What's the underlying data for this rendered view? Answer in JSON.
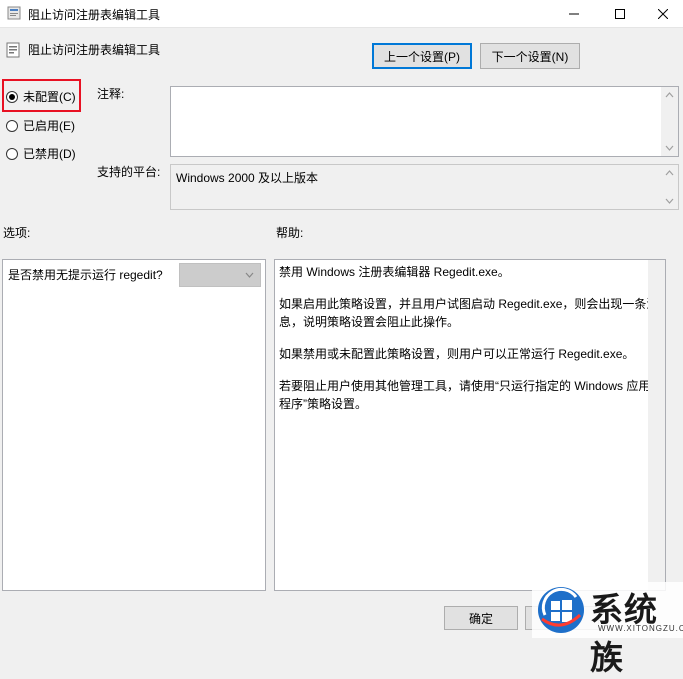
{
  "window": {
    "title": "阻止访问注册表编辑工具",
    "controls": {
      "minimize": "minimize-icon",
      "maximize": "maximize-icon",
      "close": "close-icon"
    }
  },
  "policy": {
    "title": "阻止访问注册表编辑工具",
    "icon": "policy-settings-icon"
  },
  "nav": {
    "prev_label": "上一个设置(P)",
    "next_label": "下一个设置(N)"
  },
  "state": {
    "options": [
      {
        "label": "未配置(C)",
        "checked": true
      },
      {
        "label": "已启用(E)",
        "checked": false
      },
      {
        "label": "已禁用(D)",
        "checked": false
      }
    ],
    "highlight_color": "#e81123"
  },
  "comment": {
    "label": "注释:",
    "value": ""
  },
  "platform": {
    "label": "支持的平台:",
    "value": "Windows 2000 及以上版本"
  },
  "options_section": {
    "label": "选项:",
    "question": "是否禁用无提示运行 regedit?",
    "select_value": ""
  },
  "help_section": {
    "label": "帮助:",
    "paragraphs": [
      "禁用 Windows 注册表编辑器 Regedit.exe。",
      "如果启用此策略设置，并且用户试图启动 Regedit.exe，则会出现一条消息，说明策略设置会阻止此操作。",
      "如果禁用或未配置此策略设置，则用户可以正常运行 Regedit.exe。",
      "若要阻止用户使用其他管理工具，请使用“只运行指定的 Windows 应用程序”策略设置。"
    ]
  },
  "footer": {
    "ok_label": "确定",
    "cancel_label": ""
  },
  "watermark": {
    "name": "系统族",
    "url": "WWW.XITONGZU.COM",
    "icon": "windows-logo-icon"
  },
  "colors": {
    "accent": "#0078d7",
    "window_bg": "#f0f0f0"
  }
}
